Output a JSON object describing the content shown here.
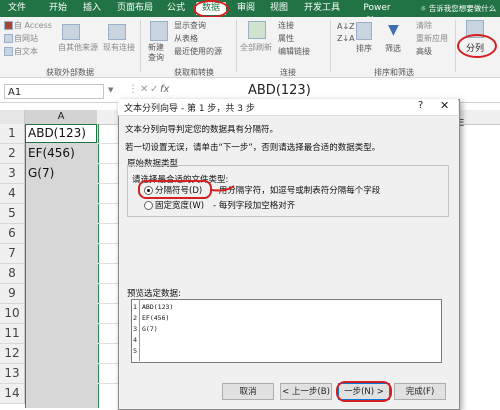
{
  "tabs": [
    "文件",
    "开始",
    "插入",
    "页面布局",
    "公式",
    "数据",
    "审阅",
    "视图",
    "开发工具",
    "Power Pivot"
  ],
  "active_tab": "数据",
  "tell_me": "告诉我您想要做什么",
  "ribbon": {
    "get_external": {
      "items": [
        "自 Access",
        "自网站",
        "自文本"
      ],
      "other_sources": "自其他来源",
      "existing": "现有连接",
      "label": "获取外部数据"
    },
    "transform": {
      "new_query": "新建",
      "new_query2": "查询",
      "show_queries": "显示查询",
      "from_table": "从表格",
      "recent": "最近使用的源",
      "label": "获取和转换"
    },
    "connections": {
      "refresh_all": "全部刷新",
      "conn": "连接",
      "props": "属性",
      "edit_links": "编辑链接",
      "label": "连接"
    },
    "sort_filter": {
      "sort": "排序",
      "filter": "筛选",
      "clear": "清除",
      "reapply": "重新应用",
      "advanced": "高级",
      "label": "排序和筛选"
    },
    "split_button": "分列"
  },
  "name_box": "A1",
  "formula_bar": {
    "fx": "fx",
    "value": "ABD(123)"
  },
  "column_a": "A",
  "rows": [
    "1",
    "2",
    "3",
    "4",
    "5",
    "6",
    "7",
    "8",
    "9",
    "10",
    "11",
    "12",
    "13",
    "14"
  ],
  "cells": [
    "ABD(123)",
    "EF(456)",
    "G(7)"
  ],
  "dialog": {
    "title": "文本分列向导 - 第 1 步，共 3 步",
    "help": "?",
    "close": "✕",
    "line1": "文本分列向导判定您的数据具有分隔符。",
    "line2": "若一切设置无误，请单击“下一步”，否则请选择最合适的数据类型。",
    "group_label": "原始数据类型",
    "choose_label": "请选择最合适的文件类型:",
    "opt1": "分隔符号(D)",
    "opt1_desc": "- 用分隔字符，如逗号或制表符分隔每个字段",
    "opt2": "固定宽度(W)",
    "opt2_desc": "- 每列字段加空格对齐",
    "preview_label": "预览选定数据:",
    "preview_lines": [
      "ABD(123)",
      "EF(456)",
      "G(7)",
      "",
      ""
    ],
    "preview_nums": [
      "1",
      "2",
      "3",
      "4",
      "5"
    ],
    "buttons": {
      "cancel": "取消",
      "back": "< 上一步(B)",
      "next": "一步(N) >",
      "finish": "完成(F)"
    }
  },
  "colors": {
    "excel_green": "#217346",
    "annotation_red": "#d42020"
  }
}
